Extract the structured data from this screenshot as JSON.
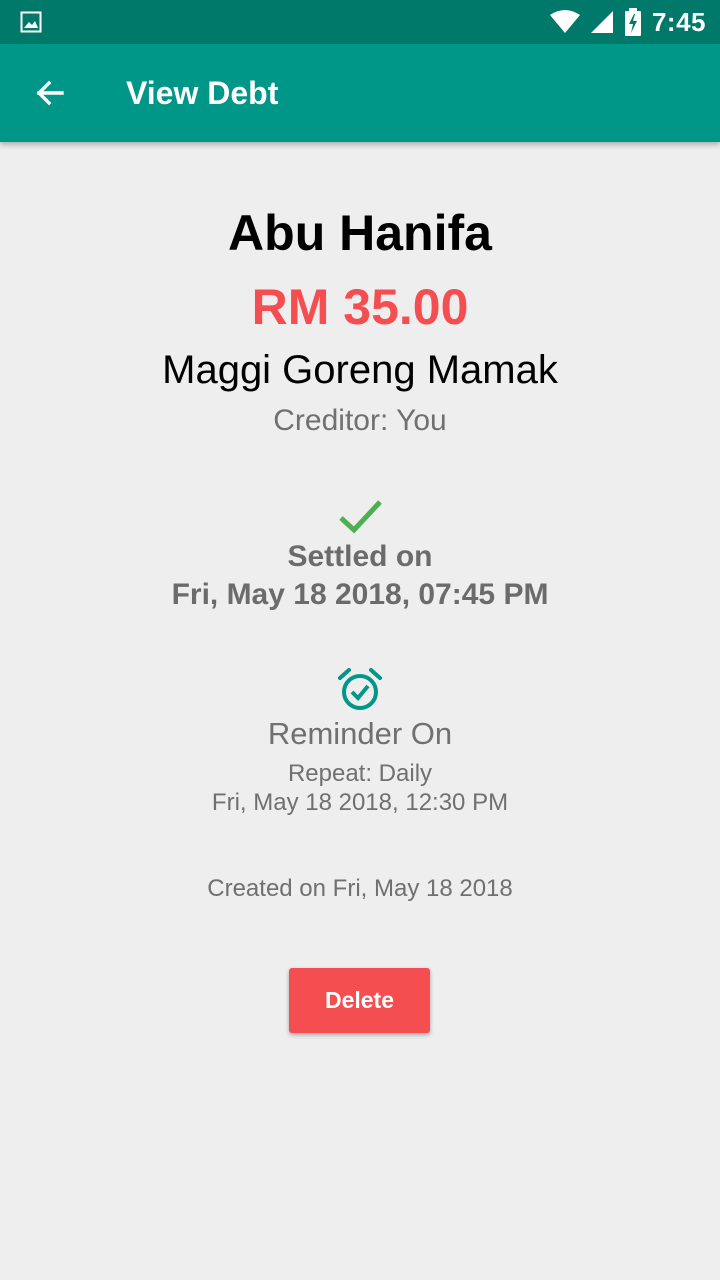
{
  "status_bar": {
    "time": "7:45",
    "icons": [
      "image-notification-icon",
      "wifi-icon",
      "cell-signal-icon",
      "battery-charging-icon"
    ]
  },
  "app_bar": {
    "title": "View Debt",
    "back_icon": "arrow-back-icon"
  },
  "debt": {
    "name": "Abu Hanifa",
    "amount": "RM 35.00",
    "description": "Maggi Goreng Mamak",
    "creditor": "Creditor: You"
  },
  "settled": {
    "icon": "check-icon",
    "label": "Settled on",
    "date": "Fri, May 18 2018, 07:45 PM"
  },
  "reminder": {
    "icon": "alarm-check-icon",
    "label": "Reminder On",
    "repeat": "Repeat: Daily",
    "date": "Fri, May 18 2018, 12:30 PM"
  },
  "created": "Created on Fri, May 18 2018",
  "actions": {
    "delete_label": "Delete"
  },
  "colors": {
    "status_bar": "#00796b",
    "app_bar": "#009688",
    "amount": "#f44e51",
    "check": "#4caf50",
    "alarm": "#009688",
    "delete_button": "#f44e51",
    "background": "#eeeeee"
  }
}
